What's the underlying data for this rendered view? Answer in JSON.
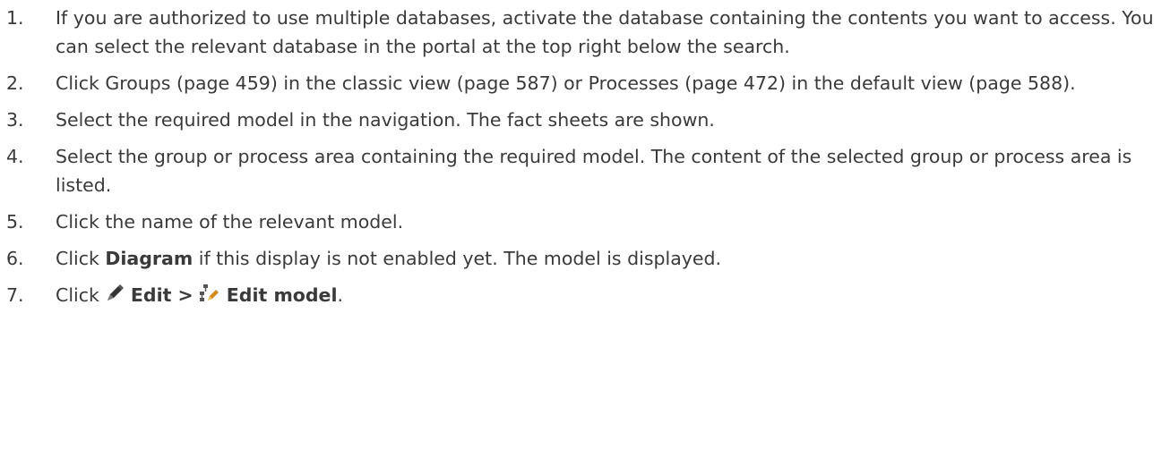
{
  "steps": [
    {
      "number": "1.",
      "text": "If you are authorized to use multiple databases, activate the database containing the contents you want to access. You can select the relevant database in the portal at the top right below the search."
    },
    {
      "number": "2.",
      "text": "Click Groups (page 459) in the classic view (page 587) or Processes (page 472) in the default view (page 588)."
    },
    {
      "number": "3.",
      "text": "Select the required model in the navigation. The fact sheets are shown."
    },
    {
      "number": "4.",
      "text": "Select the group or process area containing the required model. The content of the selected group or process area is listed."
    },
    {
      "number": "5.",
      "text": "Click the name of the relevant model."
    },
    {
      "number": "6.",
      "prefix": "Click ",
      "bold": "Diagram",
      "suffix": " if this display is not enabled yet. The model is displayed."
    },
    {
      "number": "7.",
      "prefix": "Click ",
      "icon1": "pencil-icon",
      "bold1": "Edit >",
      "icon2": "edit-model-icon",
      "bold2": "Edit model",
      "suffix": "."
    }
  ]
}
